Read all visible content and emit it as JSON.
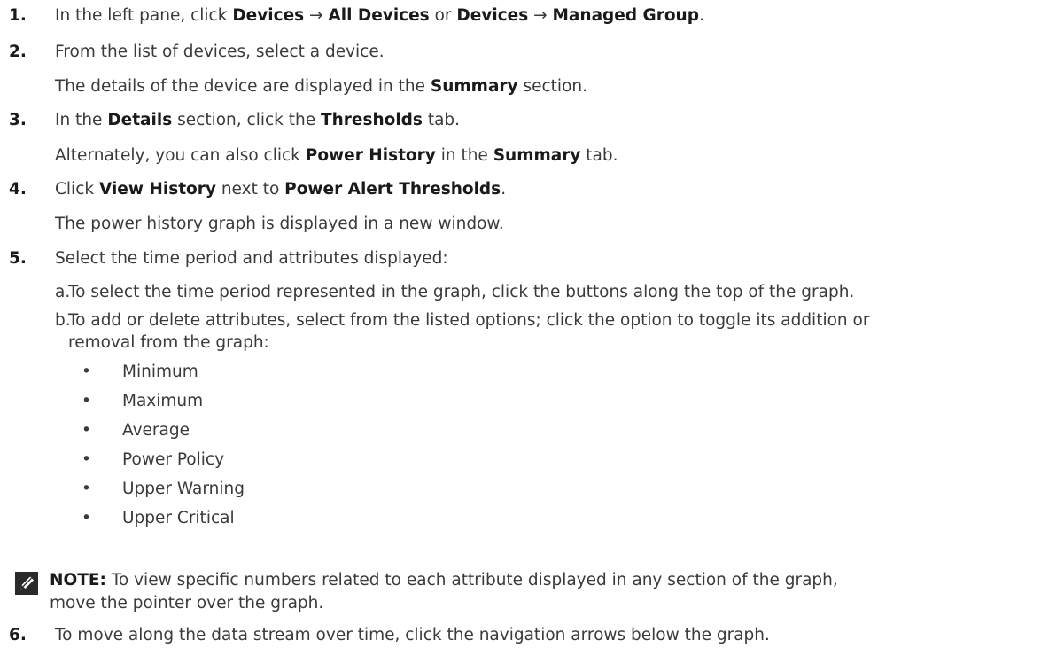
{
  "steps": [
    {
      "number": "1.",
      "parts": [
        {
          "text": "In the left pane, click ",
          "bold": false
        },
        {
          "text": "Devices",
          "bold": true
        },
        {
          "text": " → ",
          "bold": false
        },
        {
          "text": "All Devices",
          "bold": true
        },
        {
          "text": " or ",
          "bold": false
        },
        {
          "text": "Devices",
          "bold": true
        },
        {
          "text": " → ",
          "bold": false
        },
        {
          "text": "Managed Group",
          "bold": true
        },
        {
          "text": ".",
          "bold": false
        }
      ]
    },
    {
      "number": "2.",
      "text": "From the list of devices, select a device.",
      "result_parts": [
        {
          "text": "The details of the device are displayed in the ",
          "bold": false
        },
        {
          "text": "Summary",
          "bold": true
        },
        {
          "text": " section.",
          "bold": false
        }
      ]
    },
    {
      "number": "3.",
      "parts": [
        {
          "text": "In the ",
          "bold": false
        },
        {
          "text": "Details",
          "bold": true
        },
        {
          "text": " section, click the ",
          "bold": false
        },
        {
          "text": "Thresholds",
          "bold": true
        },
        {
          "text": " tab.",
          "bold": false
        }
      ],
      "result_parts": [
        {
          "text": "Alternately, you can also click ",
          "bold": false
        },
        {
          "text": "Power History",
          "bold": true
        },
        {
          "text": " in the ",
          "bold": false
        },
        {
          "text": "Summary",
          "bold": true
        },
        {
          "text": " tab.",
          "bold": false
        }
      ]
    },
    {
      "number": "4.",
      "parts": [
        {
          "text": "Click ",
          "bold": false
        },
        {
          "text": "View History",
          "bold": true
        },
        {
          "text": " next to ",
          "bold": false
        },
        {
          "text": "Power Alert Thresholds",
          "bold": true
        },
        {
          "text": ".",
          "bold": false
        }
      ],
      "result": "The power history graph is displayed in a new window."
    },
    {
      "number": "5.",
      "text": "Select the time period and attributes displayed:",
      "substeps": [
        {
          "letter": "a.",
          "lines": [
            "To select the time period represented in the graph, click the buttons along the top of the graph."
          ]
        },
        {
          "letter": "b.",
          "lines": [
            "To add or delete attributes, select from the listed options; click the option to toggle its addition or",
            "removal from the graph:"
          ]
        }
      ],
      "bullets": [
        "Minimum",
        "Maximum",
        "Average",
        "Power Policy",
        "Upper Warning",
        "Upper Critical"
      ],
      "note": {
        "label": "NOTE:",
        "lines": [
          " To view specific numbers related to each attribute displayed in any section of the graph,",
          "move the pointer over the graph."
        ]
      }
    },
    {
      "number": "6.",
      "text": "To move along the data stream over time, click the navigation arrows below the graph."
    }
  ],
  "bullet_char": "•",
  "icon": "note-pencil-icon"
}
